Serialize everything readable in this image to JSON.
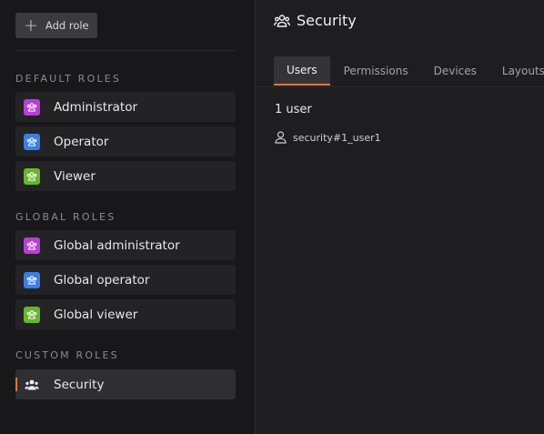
{
  "sidebar": {
    "add_role_label": "Add role",
    "sections": [
      {
        "title": "DEFAULT ROLES"
      },
      {
        "title": "GLOBAL ROLES"
      },
      {
        "title": "CUSTOM ROLES"
      }
    ],
    "roles": [
      {
        "label": "Administrator",
        "color": "#b83fd3",
        "icon": "users-icon"
      },
      {
        "label": "Operator",
        "color": "#3b7ee8",
        "icon": "users-icon"
      },
      {
        "label": "Viewer",
        "color": "#66b82a",
        "icon": "users-icon"
      },
      {
        "label": "Global administrator",
        "color": "#b83fd3",
        "icon": "users-icon"
      },
      {
        "label": "Global operator",
        "color": "#3b7ee8",
        "icon": "users-icon"
      },
      {
        "label": "Global viewer",
        "color": "#66b82a",
        "icon": "users-icon"
      },
      {
        "label": "Security",
        "color": "#e0763a",
        "icon": "users-icon",
        "selected": true
      }
    ]
  },
  "header": {
    "title": "Security",
    "icon": "users-icon"
  },
  "tabs": [
    {
      "label": "Users",
      "active": true
    },
    {
      "label": "Permissions"
    },
    {
      "label": "Devices"
    },
    {
      "label": "Layouts"
    }
  ],
  "users": {
    "count_label": "1 user",
    "list": [
      {
        "name": "security#1_user1",
        "icon": "user-icon"
      }
    ]
  }
}
